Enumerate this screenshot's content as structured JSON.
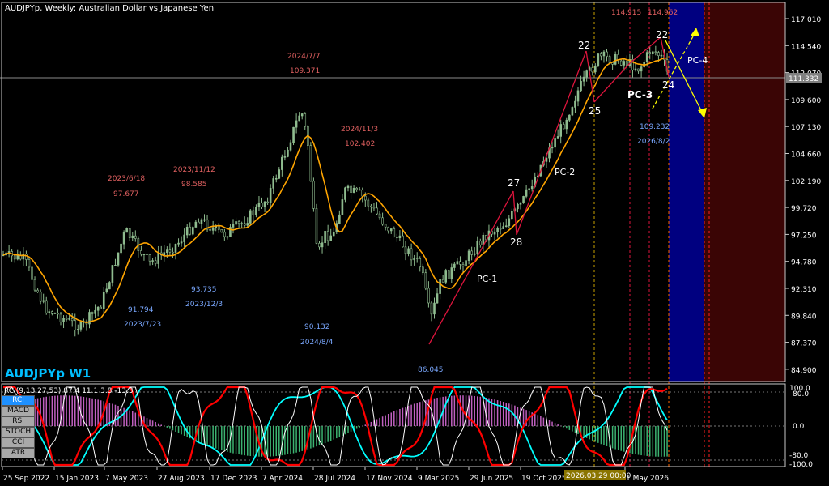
{
  "header": {
    "title": "AUDJPYp, Weekly:  Australian Dollar vs Japanese Yen",
    "watermark": "AUDJPYp W1"
  },
  "price_axis": {
    "labels": [
      "117.010",
      "114.540",
      "112.070",
      "109.600",
      "107.130",
      "104.660",
      "102.190",
      "99.720",
      "97.250",
      "94.780",
      "92.310",
      "89.840",
      "87.370",
      "84.900"
    ],
    "current_price": "111.332",
    "current_price_color": "#808080"
  },
  "time_axis": {
    "labels": [
      "25 Sep 2022",
      "15 Jan 2023",
      "7 May 2023",
      "27 Aug 2023",
      "17 Dec 2023",
      "7 Apr 2024",
      "28 Jul 2024",
      "17 Nov 2024",
      "9 Mar 2025",
      "29 Jun 2025",
      "19 Oct 2025",
      "1 May 2026"
    ],
    "cursor_label": "2026.03.29 00:00"
  },
  "annotations": {
    "highs": [
      {
        "date": "2023/6/18",
        "price": "97.677"
      },
      {
        "date": "2023/11/12",
        "price": "98.585"
      },
      {
        "date": "2024/7/7",
        "price": "109.371"
      },
      {
        "date": "2024/11/3",
        "price": "102.402"
      }
    ],
    "lows": [
      {
        "price": "91.794",
        "date": "2023/7/23"
      },
      {
        "price": "93.735",
        "date": "2023/12/3"
      },
      {
        "price": "90.132",
        "date": "2024/8/4"
      },
      {
        "price": "86.045"
      }
    ],
    "top_prices": [
      "114.915",
      "114.962"
    ],
    "projection_low": {
      "price": "109.232",
      "date": "2026/8/2"
    },
    "wave_labels": [
      "22",
      "22",
      "25",
      "24",
      "27",
      "28"
    ],
    "channel_labels": [
      "PC-1",
      "PC-2",
      "PC-3",
      "PC-4"
    ]
  },
  "indicator": {
    "title": "RCI(9,13,27,53) 87.4 11.1 3.8 -13.3",
    "axis_labels": [
      "100.0",
      "80.0",
      "0.0",
      "-80.0",
      "-100.0"
    ],
    "tabs": [
      "RCI",
      "MACD",
      "RSI",
      "STOCH",
      "CCI",
      "ATR"
    ],
    "active_tab": "RCI"
  },
  "colors": {
    "bull_candle": "#8fbc8f",
    "ma_line": "#ffa500",
    "wave_line": "#dc143c",
    "projection_arrow": "#ffff00",
    "future_blue": "#000080",
    "future_red": "#3a0505",
    "rci_fast": "#ffffff",
    "rci_mid": "#ff0000",
    "rci_slow": "#00ffff"
  }
}
